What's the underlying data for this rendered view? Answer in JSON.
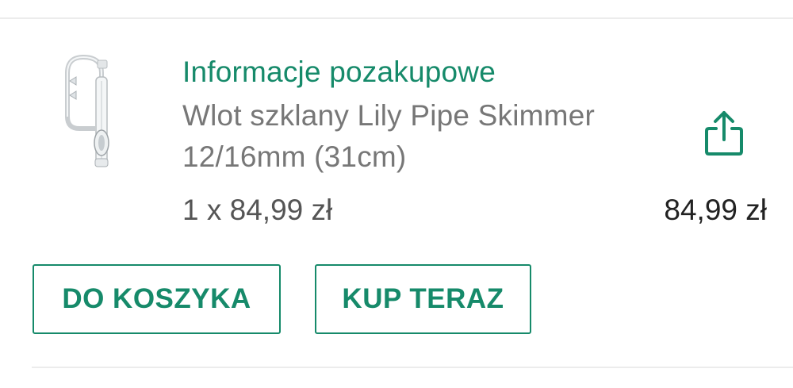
{
  "order_item": {
    "info_link_label": "Informacje pozakupowe",
    "product_name": "Wlot szklany Lily Pipe Skimmer 12/16mm (31cm)",
    "quantity_price": "1 x 84,99 zł",
    "total_price": "84,99 zł",
    "thumbnail_icon": "glass-lily-pipe-image",
    "share_icon": "share-icon"
  },
  "actions": {
    "add_to_cart_label": "DO KOSZYKA",
    "buy_now_label": "KUP TERAZ"
  },
  "colors": {
    "accent": "#168a6a",
    "text_secondary": "#777777",
    "text_primary": "#222222",
    "divider": "#ececec"
  }
}
